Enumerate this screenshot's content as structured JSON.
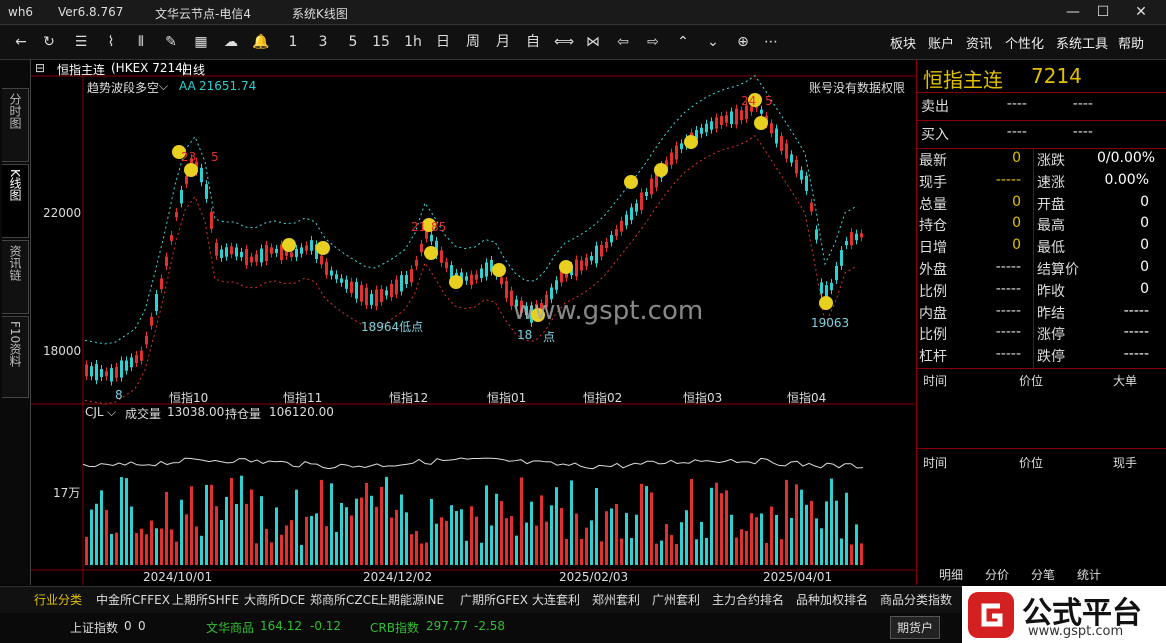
{
  "window": {
    "code": "wh6",
    "version": "Ver6.8.767",
    "server": "文华云节点-电信4",
    "title": "系统K线图"
  },
  "toolbar": {
    "period_buttons": [
      "1",
      "3",
      "5",
      "15",
      "1h",
      "日",
      "周",
      "月",
      "自"
    ],
    "menu": [
      "板块",
      "账户",
      "资讯",
      "个性化",
      "系统工具",
      "帮助"
    ]
  },
  "side_tabs": [
    "分时图",
    "K线图",
    "资讯链",
    "F10资料"
  ],
  "contract": {
    "name": "恒指主连",
    "code": "(HKEX 7214)",
    "period": "日线",
    "code_short": "7214"
  },
  "indicator_main": {
    "name": "趋势波段多空",
    "aa_label": "AA",
    "aa_value": "21651.74",
    "no_permission": "账号没有数据权限"
  },
  "watermark": "www.gspt.com",
  "price_axis": [
    "22000",
    "18000"
  ],
  "vol_axis": [
    "17万"
  ],
  "annotations": {
    "low1": "18964低点",
    "low2": "18",
    "low2b": "点",
    "low3": "19063",
    "high1": "23",
    "high1b": "5",
    "high2": "21",
    "high2b": "85",
    "high3": "24",
    "high3b": "5",
    "start": "8"
  },
  "month_labels": [
    "恒指10",
    "恒指11",
    "恒指12",
    "恒指01",
    "恒指02",
    "恒指03",
    "恒指04"
  ],
  "date_labels": [
    "2024/10/01",
    "2024/12/02",
    "2025/02/03",
    "2025/04/01"
  ],
  "indicator_sub": {
    "name": "CJL",
    "vol_label": "成交量",
    "vol_value": "13038.00",
    "oi_label": "持仓量",
    "oi_value": "106120.00"
  },
  "panel": {
    "title": "恒指主连",
    "code": "7214",
    "sell": {
      "label": "卖出",
      "price": "----",
      "vol": "----"
    },
    "buy": {
      "label": "买入",
      "price": "----",
      "vol": "----"
    },
    "left": [
      {
        "label": "最新",
        "value": "0"
      },
      {
        "label": "现手",
        "value": "-----"
      },
      {
        "label": "总量",
        "value": "0"
      },
      {
        "label": "持仓",
        "value": "0"
      },
      {
        "label": "日增",
        "value": "0"
      },
      {
        "label": "外盘",
        "value": "-----"
      },
      {
        "label": "比例",
        "value": "-----"
      },
      {
        "label": "内盘",
        "value": "-----"
      },
      {
        "label": "比例",
        "value": "-----"
      },
      {
        "label": "杠杆",
        "value": "-----"
      }
    ],
    "right": [
      {
        "label": "涨跌",
        "value": "0/0.00%"
      },
      {
        "label": "速涨",
        "value": "0.00%"
      },
      {
        "label": "开盘",
        "value": "0"
      },
      {
        "label": "最高",
        "value": "0"
      },
      {
        "label": "最低",
        "value": "0"
      },
      {
        "label": "结算价",
        "value": "0"
      },
      {
        "label": "昨收",
        "value": "0"
      },
      {
        "label": "昨结",
        "value": "-----"
      },
      {
        "label": "涨停",
        "value": "-----"
      },
      {
        "label": "跌停",
        "value": "-----"
      }
    ],
    "trade_head1": [
      "时间",
      "价位",
      "大单"
    ],
    "trade_head2": [
      "时间",
      "价位",
      "现手"
    ],
    "tabs": [
      "明细",
      "分价",
      "分笔",
      "统计"
    ]
  },
  "bottom_tabs": [
    "行业分类",
    "中金所CFFEX",
    "上期所SHFE",
    "大商所DCE",
    "郑商所CZCE",
    "上期能源INE",
    "广期所GFEX",
    "大连套利",
    "郑州套利",
    "广州套利",
    "主力合约排名",
    "品种加权排名",
    "商品分类指数"
  ],
  "status": {
    "sh_label": "上证指数",
    "sh_v1": "0",
    "sh_v2": "0",
    "wh_label": "文华商品",
    "wh_v1": "164.12",
    "wh_v2": "-0.12",
    "crb_label": "CRB指数",
    "crb_v1": "297.77",
    "crb_v2": "-2.58",
    "qihuo_btn": "期货户"
  },
  "logo": {
    "text": "公式平台",
    "url": "www.gspt.com"
  },
  "colors": {
    "up": "#e03030",
    "down": "#30d0d0",
    "accent": "#e0c000"
  }
}
